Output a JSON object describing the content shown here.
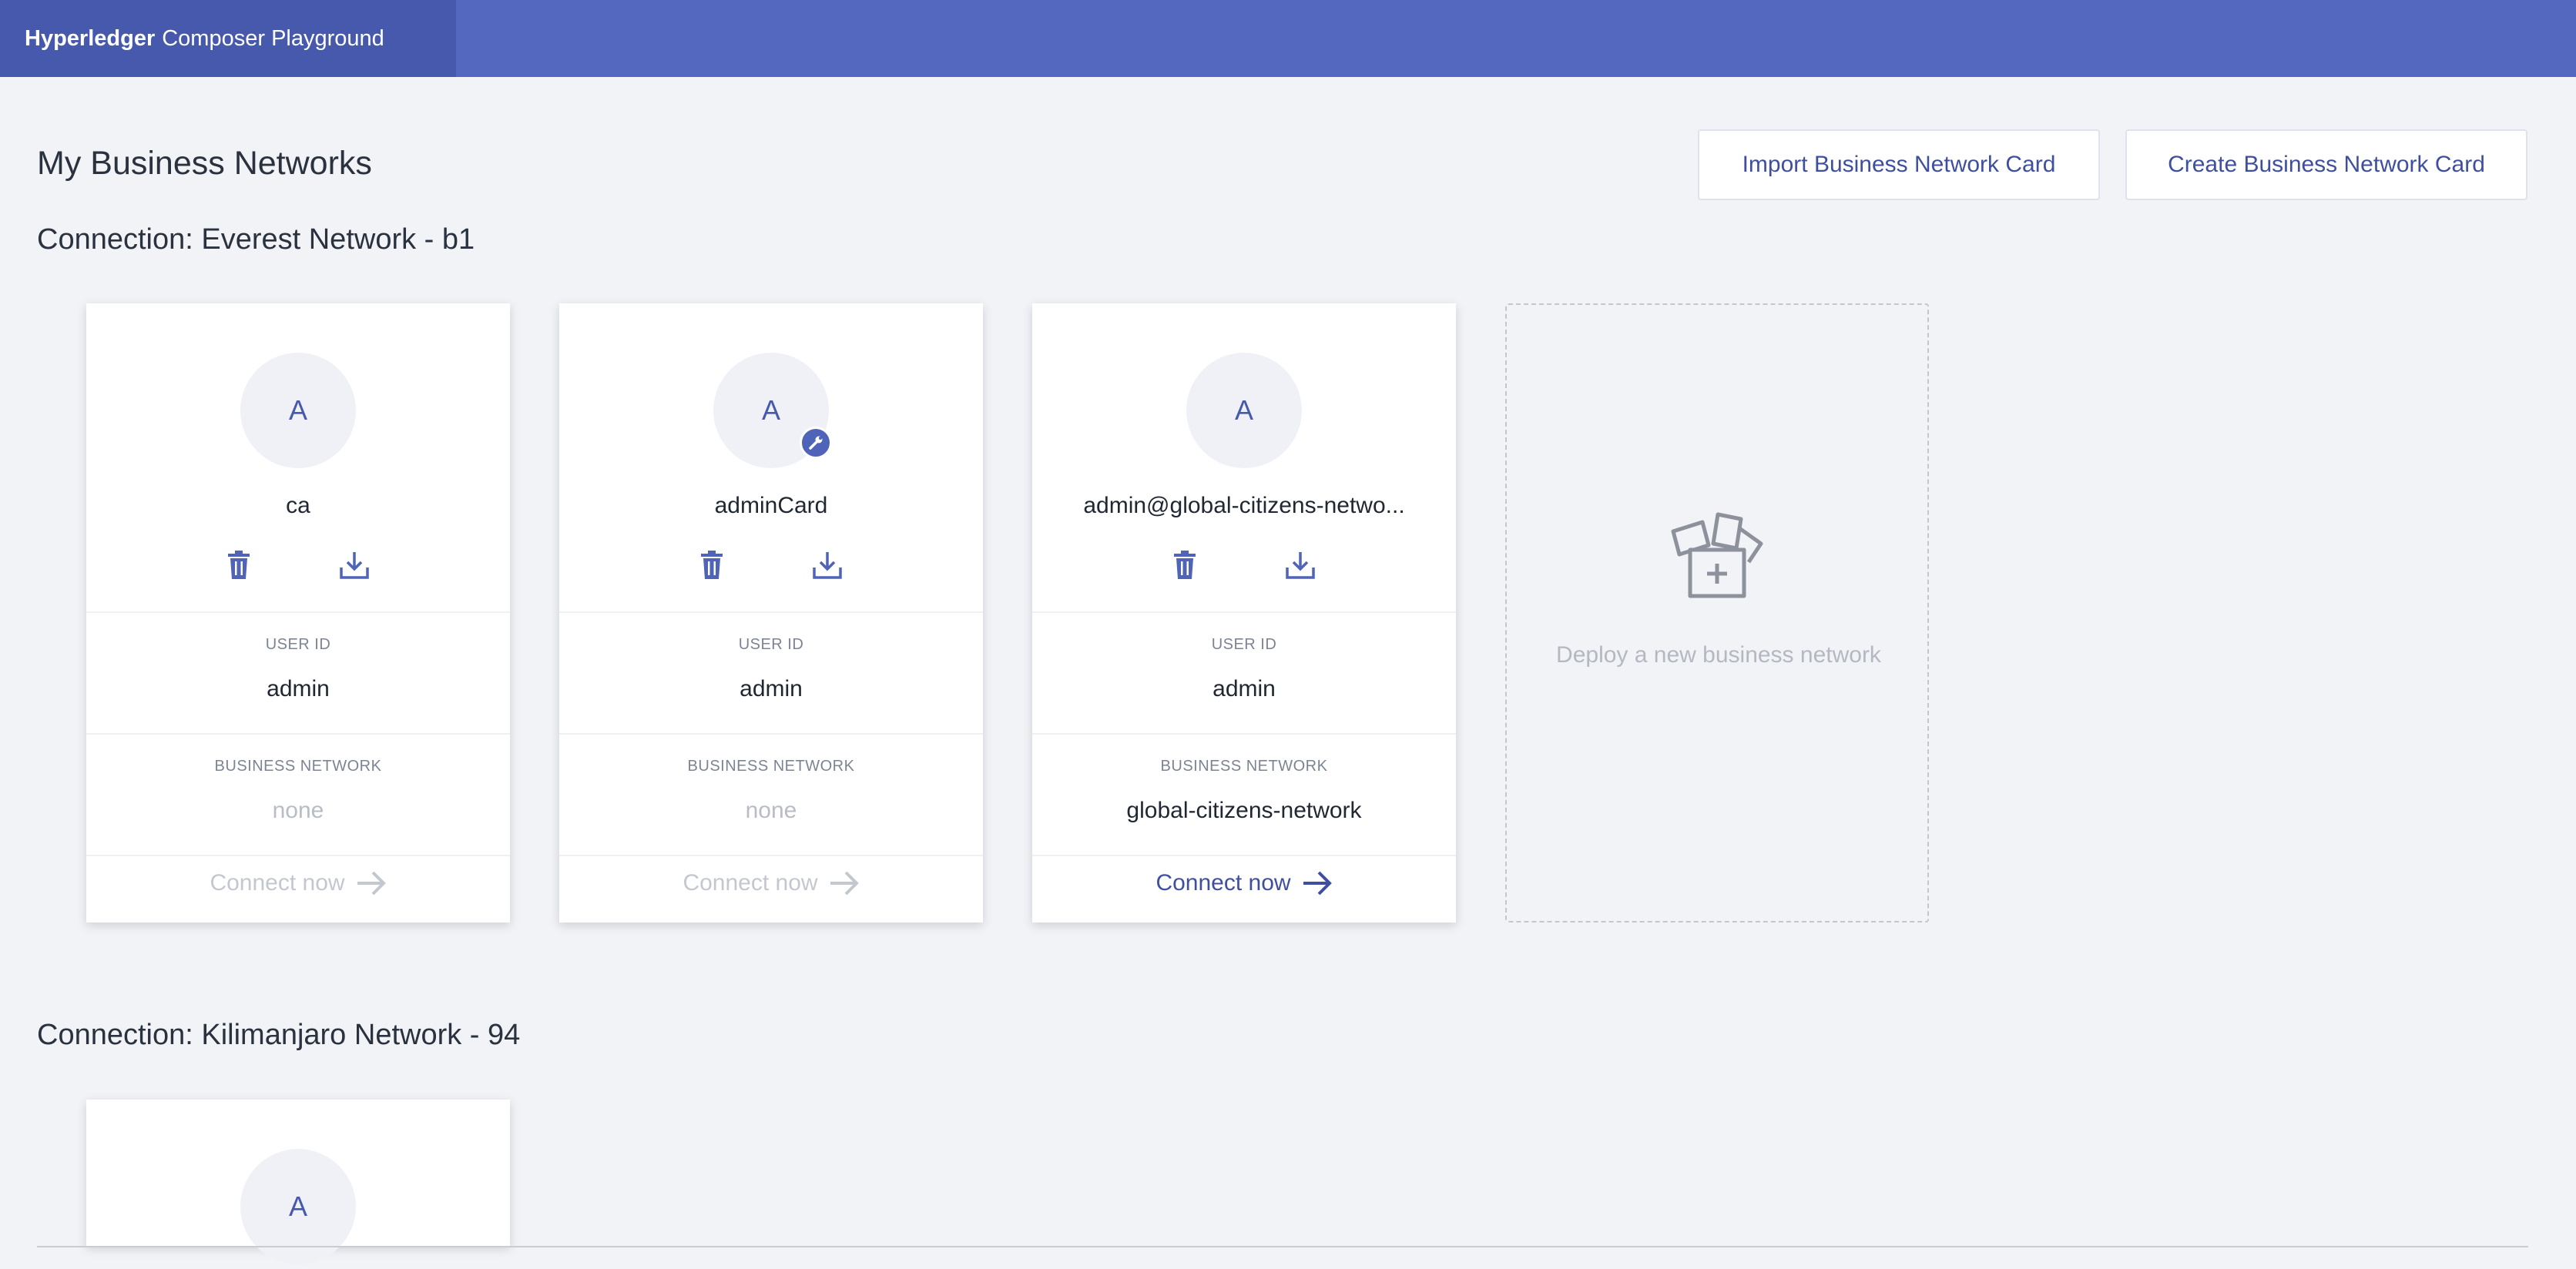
{
  "app": {
    "brand_bold": "Hyperledger",
    "brand_rest": "Composer Playground"
  },
  "header": {
    "title": "My Business Networks",
    "import_label": "Import Business Network Card",
    "create_label": "Create Business Network Card"
  },
  "labels": {
    "user_id": "USER ID",
    "business_network": "BUSINESS NETWORK",
    "connect_now": "Connect now"
  },
  "connections": [
    {
      "title": "Connection: Everest Network - b1",
      "cards": [
        {
          "initial": "A",
          "name": "ca",
          "user_id": "admin",
          "business_network": "none",
          "connect_enabled": false,
          "badge": false
        },
        {
          "initial": "A",
          "name": "adminCard",
          "user_id": "admin",
          "business_network": "none",
          "connect_enabled": false,
          "badge": "wrench-icon"
        },
        {
          "initial": "A",
          "name": "admin@global-citizens-netwo...",
          "user_id": "admin",
          "business_network": "global-citizens-network",
          "connect_enabled": true,
          "badge": false
        }
      ],
      "deploy_label": "Deploy a new business network"
    },
    {
      "title": "Connection: Kilimanjaro Network - 94",
      "cards": [
        {
          "initial": "A"
        }
      ]
    }
  ],
  "colors": {
    "accent": "#5468bf",
    "accent_dark": "#4659ad",
    "link": "#3f4f9f",
    "background": "#f2f3f6"
  }
}
